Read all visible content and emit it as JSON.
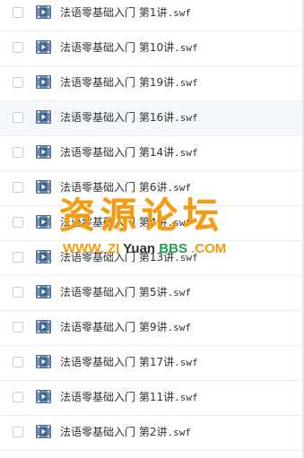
{
  "file_list": {
    "items": [
      {
        "name": "法语零基础入门 第1讲",
        "ext": ".swf",
        "highlighted": false
      },
      {
        "name": "法语零基础入门 第10讲",
        "ext": ".swf",
        "highlighted": false
      },
      {
        "name": "法语零基础入门 第19讲",
        "ext": ".swf",
        "highlighted": false
      },
      {
        "name": "法语零基础入门 第16讲",
        "ext": ".swf",
        "highlighted": true
      },
      {
        "name": "法语零基础入门 第14讲",
        "ext": ".swf",
        "highlighted": false
      },
      {
        "name": "法语零基础入门 第6讲",
        "ext": ".swf",
        "highlighted": false
      },
      {
        "name": "法语零基础入门 第4讲",
        "ext": ".swf",
        "highlighted": false
      },
      {
        "name": "法语零基础入门 第13讲",
        "ext": ".swf",
        "highlighted": false
      },
      {
        "name": "法语零基础入门 第5讲",
        "ext": ".swf",
        "highlighted": false
      },
      {
        "name": "法语零基础入门 第9讲",
        "ext": ".swf",
        "highlighted": false
      },
      {
        "name": "法语零基础入门 第17讲",
        "ext": ".swf",
        "highlighted": false
      },
      {
        "name": "法语零基础入门 第11讲",
        "ext": ".swf",
        "highlighted": false
      },
      {
        "name": "法语零基础入门 第2讲",
        "ext": ".swf",
        "highlighted": false
      }
    ],
    "file_icon": "video-file-icon"
  },
  "watermark": {
    "title": "资源论坛",
    "url_www": "WWW.",
    "url_zi": "ZI",
    "url_yuan": "Yuan",
    "url_bbs": "BBS",
    "url_com": ".COM"
  },
  "colors": {
    "watermark_orange": "#f59b10",
    "watermark_green": "#21a24a",
    "icon_blue": "#5a7fa6",
    "highlight_row": "#f5f9fd"
  }
}
